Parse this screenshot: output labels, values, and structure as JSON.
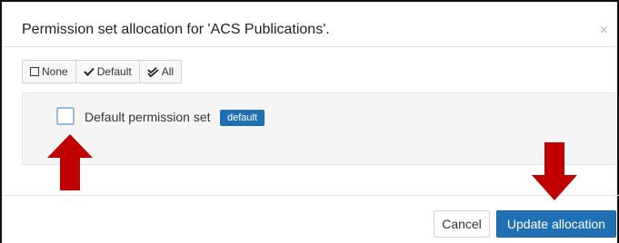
{
  "dialog": {
    "title": "Permission set allocation for 'ACS Publications'.",
    "close_glyph": "×"
  },
  "selection_buttons": [
    {
      "label": "None",
      "icon": "square-outline-icon"
    },
    {
      "label": "Default",
      "icon": "checkmark-icon"
    },
    {
      "label": "All",
      "icon": "double-checkmark-icon"
    }
  ],
  "permission_sets": [
    {
      "label": "Default permission set",
      "badge": "default",
      "checked": false
    }
  ],
  "footer": {
    "cancel_label": "Cancel",
    "submit_label": "Update allocation"
  },
  "annotations": {
    "arrow_color": "#c00000",
    "arrows": [
      {
        "direction": "up",
        "target": "checkbox"
      },
      {
        "direction": "down",
        "target": "update-allocation-button"
      }
    ]
  },
  "colors": {
    "primary": "#1f6fb2",
    "panel_bg": "#f5f5f5",
    "checkbox_border": "#9bbcd8"
  }
}
